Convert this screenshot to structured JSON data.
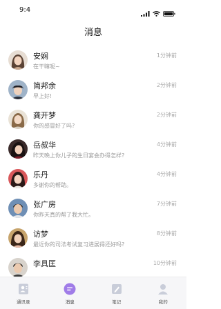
{
  "status_bar": {
    "time": "9:4"
  },
  "header": {
    "title": "消息"
  },
  "colors": {
    "accent": "#a07ce8",
    "inactive_icon": "#c9cdd9"
  },
  "messages": [
    {
      "name": "安娴",
      "preview": "在干嘛呢~",
      "time": "1分钟前",
      "avatar": "avatar-woman-1"
    },
    {
      "name": "简邦余",
      "preview": "早上好!",
      "time": "2分钟前",
      "avatar": "avatar-man-1"
    },
    {
      "name": "龚开梦",
      "preview": "你的感冒好了吗?",
      "time": "2分钟前",
      "avatar": "avatar-woman-2"
    },
    {
      "name": "岳叔华",
      "preview": "昨天晚上你儿子的生日宴会办得怎样?",
      "time": "4分钟前",
      "avatar": "avatar-woman-3"
    },
    {
      "name": "乐丹",
      "preview": "多谢你的帮助。",
      "time": "4分钟前",
      "avatar": "avatar-woman-4"
    },
    {
      "name": "张广房",
      "preview": "你昨天真的帮了我大忙。",
      "time": "7分钟前",
      "avatar": "avatar-man-2"
    },
    {
      "name": "访梦",
      "preview": "最近你的司法考试复习进展得还好吗?",
      "time": "8分钟前",
      "avatar": "avatar-woman-5"
    },
    {
      "name": "李具匡",
      "preview": "",
      "time": "10分钟前",
      "avatar": "avatar-man-3"
    }
  ],
  "tab_bar": {
    "tabs": [
      {
        "label": "通讯录",
        "icon": "contacts-icon",
        "active": false
      },
      {
        "label": "消息",
        "icon": "message-icon",
        "active": true
      },
      {
        "label": "笔记",
        "icon": "note-icon",
        "active": false
      },
      {
        "label": "我的",
        "icon": "profile-icon",
        "active": false
      }
    ]
  }
}
